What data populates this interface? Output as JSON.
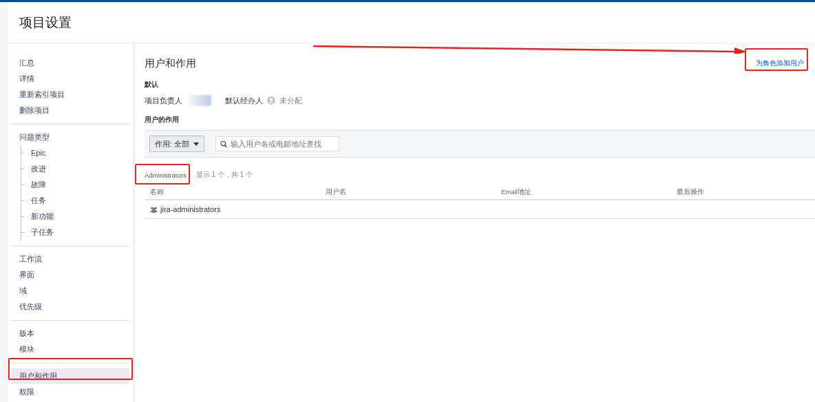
{
  "page": {
    "title": "项目设置"
  },
  "sidebar": {
    "groups": [
      {
        "items": [
          {
            "label": "汇总",
            "selected": false
          },
          {
            "label": "详情",
            "selected": false
          },
          {
            "label": "重新索引项目",
            "selected": false
          },
          {
            "label": "删除项目",
            "selected": false
          }
        ]
      },
      {
        "items": [
          {
            "label": "问题类型",
            "selected": false,
            "children": [
              {
                "label": "Epic",
                "selected": false
              },
              {
                "label": "改进",
                "selected": false
              },
              {
                "label": "故障",
                "selected": false
              },
              {
                "label": "任务",
                "selected": false
              },
              {
                "label": "新功能",
                "selected": false
              },
              {
                "label": "子任务",
                "selected": false
              }
            ]
          }
        ]
      },
      {
        "items": [
          {
            "label": "工作流",
            "selected": false
          },
          {
            "label": "界面",
            "selected": false
          },
          {
            "label": "域",
            "selected": false
          },
          {
            "label": "优先级",
            "selected": false
          }
        ]
      },
      {
        "items": [
          {
            "label": "版本",
            "selected": false
          },
          {
            "label": "模块",
            "selected": false
          }
        ]
      },
      {
        "items": [
          {
            "label": "用户和作用",
            "selected": true
          },
          {
            "label": "权限",
            "selected": false
          }
        ]
      }
    ]
  },
  "main": {
    "title": "用户和作用",
    "add_button": "为角色添加用户",
    "defaults": {
      "heading": "默认",
      "lead_label": "项目负责人",
      "assignee_label": "默认经办人",
      "assignee_value": "未分配"
    },
    "roles": {
      "heading": "用户的作用",
      "filter": "作用: 全部",
      "search_placeholder": "输入用户名或电邮地址查找"
    },
    "role_tables": [
      {
        "name": "Administrators",
        "count": "显示 1 个，共 1 个",
        "columns": [
          "名称",
          "用户名",
          "Email地址",
          "最后操作"
        ],
        "rows": [
          {
            "kind": "group",
            "cells": [
              "jira-administrators"
            ]
          }
        ]
      }
    ]
  }
}
